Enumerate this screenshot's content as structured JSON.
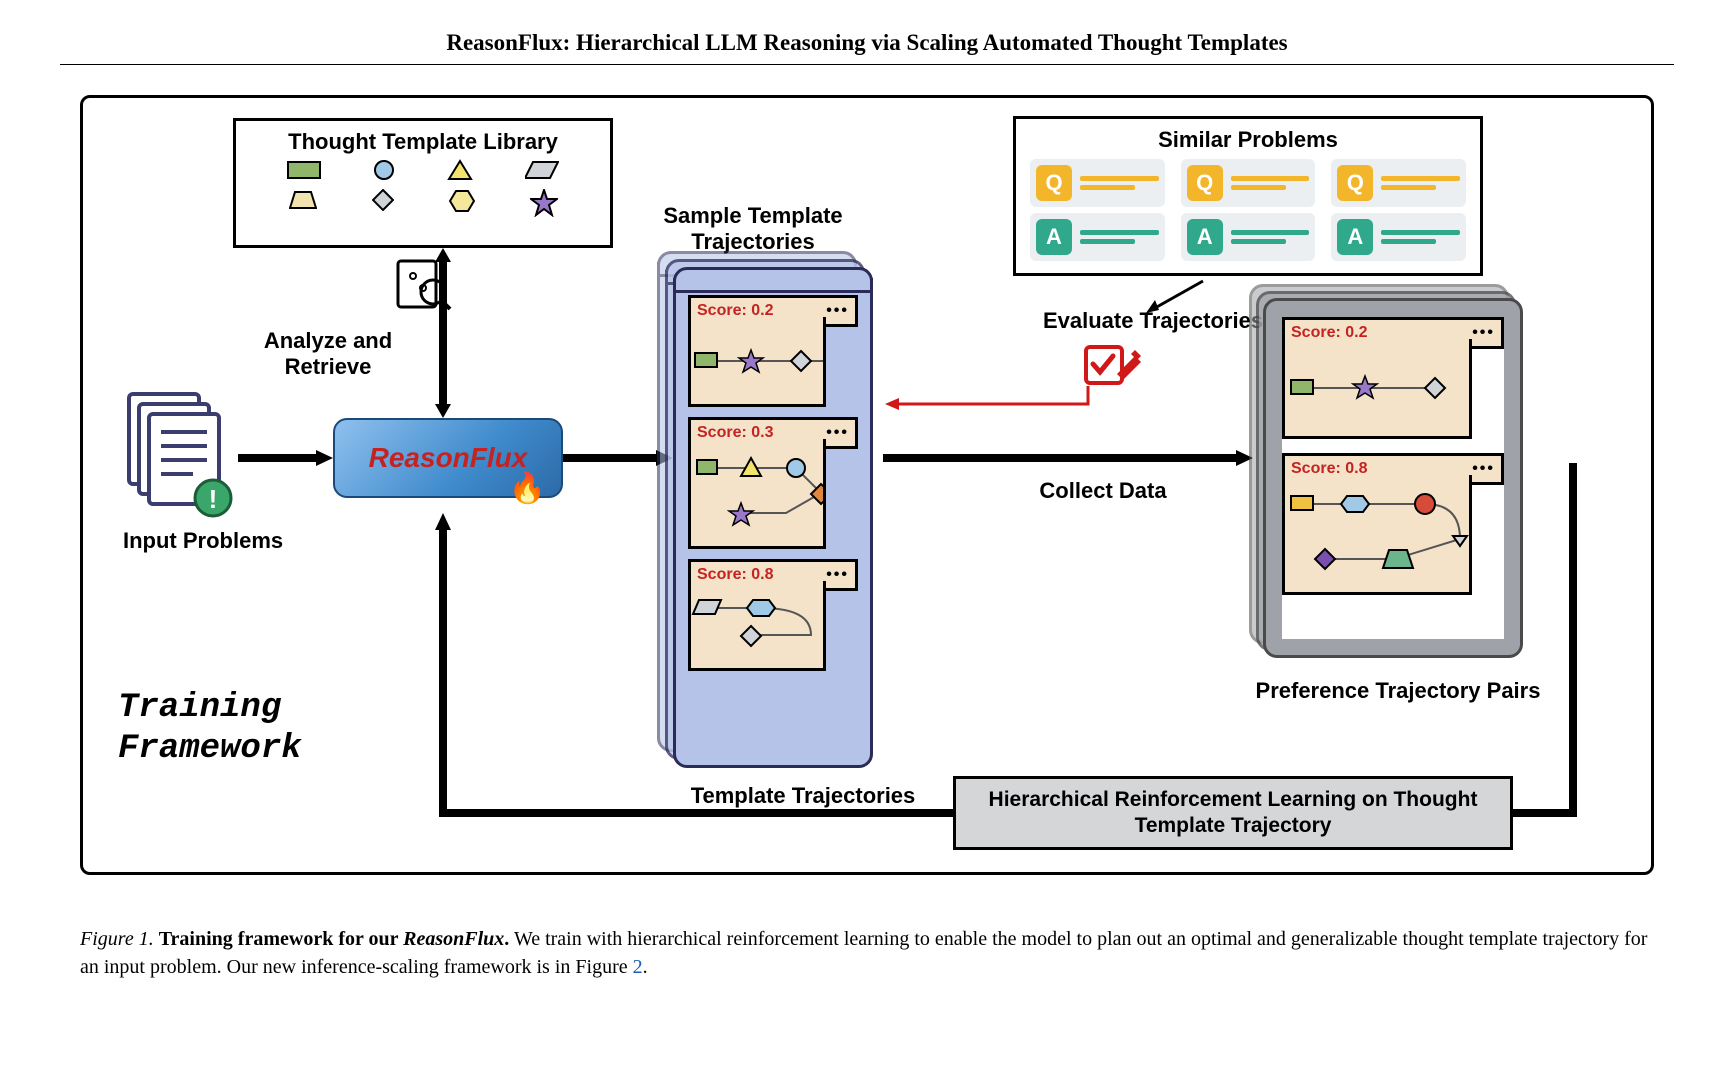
{
  "title": "ReasonFlux: Hierarchical LLM Reasoning via Scaling Automated Thought Templates",
  "box_ttl": "Thought Template Library",
  "analyze_retrieve": "Analyze and Retrieve",
  "reasonflux": "ReasonFlux",
  "input_problems": "Input Problems",
  "sample_tt": "Sample Template Trajectories",
  "template_traj": "Template Trajectories",
  "similar_problems": "Similar Problems",
  "evaluate_traj": "Evaluate Trajectories",
  "collect_data": "Collect Data",
  "pref_pairs": "Preference Trajectory Pairs",
  "hrl": "Hierarchical Reinforcement Learning on Thought Template Trajectory",
  "training_framework": "Training Framework",
  "scores": {
    "s1": "Score: 0.2",
    "s2": "Score: 0.3",
    "s3": "Score: 0.8"
  },
  "pref_scores": {
    "top": "Score: 0.2",
    "bot": "Score: 0.8"
  },
  "caption": {
    "lead": "Figure 1.",
    "bold": "Training framework for our",
    "model": "ReasonFlux",
    "tail1": "We train with hierarchical reinforcement learning to enable the model to plan out an optimal and generalizable thought template trajectory for an input problem. Our new inference-scaling framework is in Figure",
    "figref": "2",
    "period": "."
  }
}
